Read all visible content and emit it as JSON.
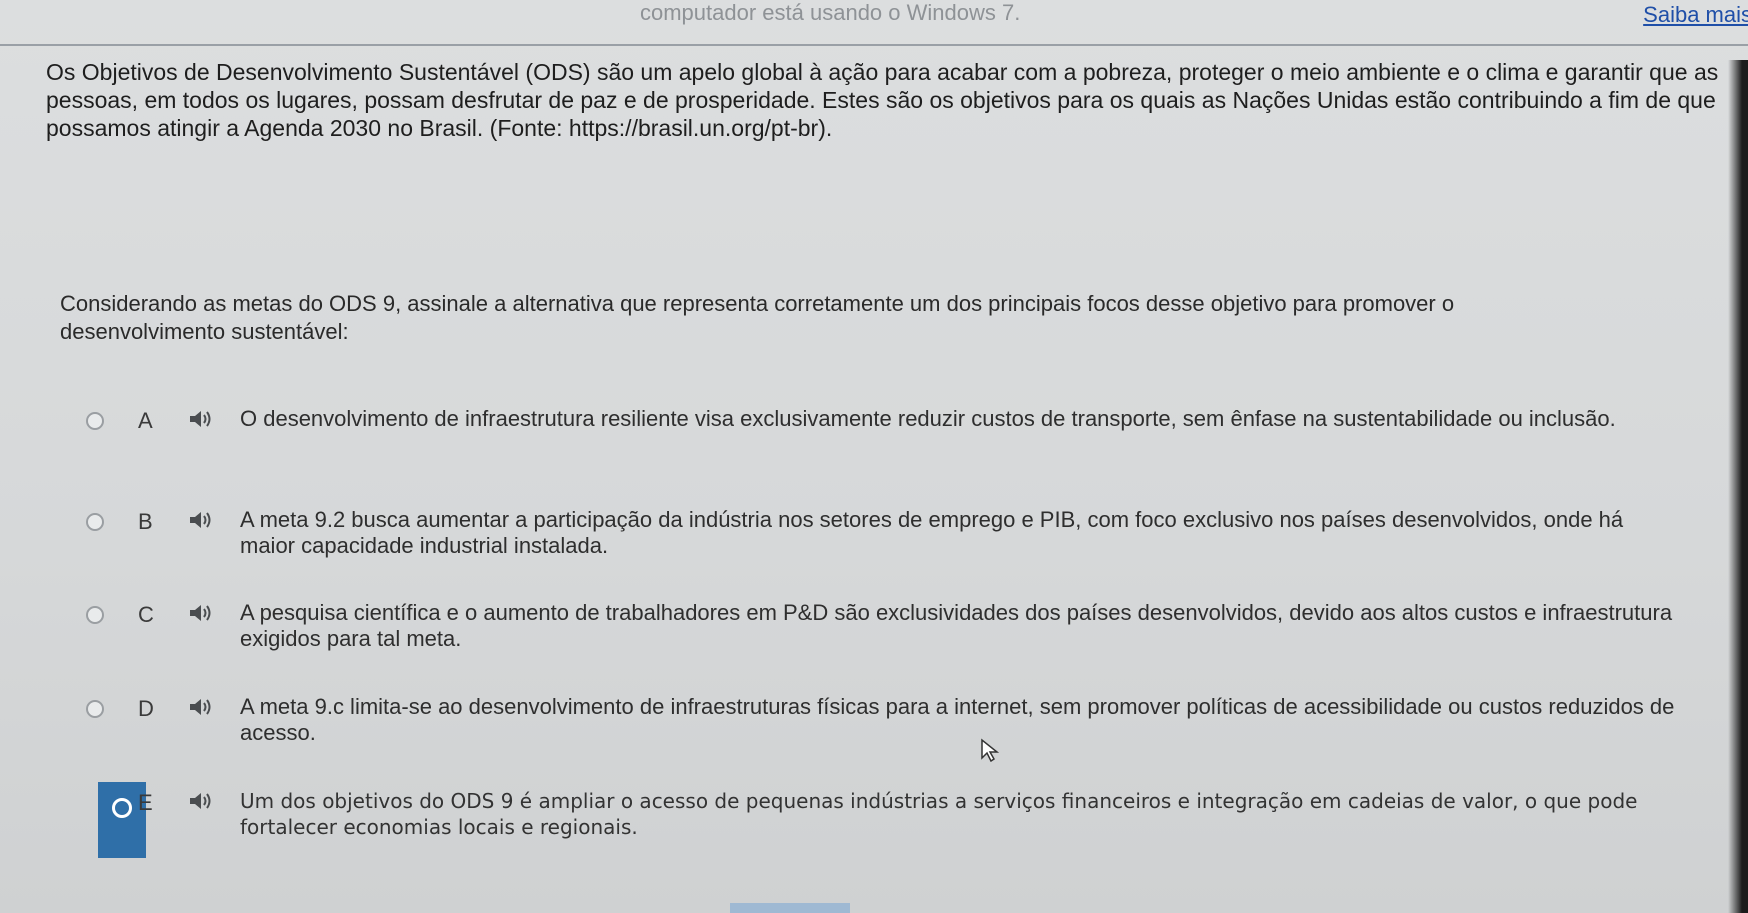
{
  "header": {
    "faded_text": "computador está usando o Windows 7.",
    "link": "Saiba mais"
  },
  "intro": "Os Objetivos de Desenvolvimento Sustentável (ODS) são um apelo global à ação para acabar com a pobreza, proteger o meio ambiente e o clima e garantir que as pessoas, em todos os lugares, possam desfrutar de paz e de prosperidade. Estes são os objetivos para os quais as Nações Unidas estão contribuindo a fim de que possamos atingir a Agenda 2030 no Brasil. (Fonte: https://brasil.un.org/pt-br).",
  "question": "Considerando as metas do ODS 9, assinale a alternativa que representa corretamente um dos principais focos desse objetivo para promover o desenvolvimento sustentável:",
  "options": [
    {
      "letter": "A",
      "text": "O desenvolvimento de infraestrutura resiliente visa exclusivamente reduzir custos de transporte, sem ênfase na sustentabilidade ou inclusão.",
      "selected": false
    },
    {
      "letter": "B",
      "text": "A meta 9.2 busca aumentar a participação da indústria nos setores de emprego e PIB, com foco exclusivo nos países desenvolvidos, onde há maior capacidade industrial instalada.",
      "selected": false
    },
    {
      "letter": "C",
      "text": "A pesquisa científica e o aumento de trabalhadores em P&D são exclusividades dos países desenvolvidos, devido aos altos custos e infraestrutura exigidos para tal meta.",
      "selected": false
    },
    {
      "letter": "D",
      "text": "A meta 9.c limita-se ao desenvolvimento de infraestruturas físicas para a internet, sem promover políticas de acessibilidade ou custos reduzidos de acesso.",
      "selected": false
    },
    {
      "letter": "E",
      "text": "Um dos objetivos do ODS 9 é ampliar o acesso de pequenas indústrias a serviços financeiros e integração em cadeias de valor, o que pode fortalecer economias locais e regionais.",
      "selected": true
    }
  ],
  "icons": {
    "speaker": "speaker-icon",
    "cursor": "mouse-pointer-icon"
  },
  "colors": {
    "selected_accent": "#2f6fa8",
    "link": "#1f4fa8"
  }
}
